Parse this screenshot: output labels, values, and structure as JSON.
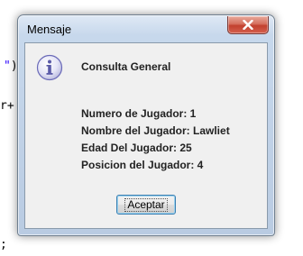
{
  "background": {
    "fragment1_str": "\"",
    "fragment1_rest": ").",
    "fragment2_text": "r+ ",
    "fragment2_str": "\"",
    "fragment3_text": ";"
  },
  "dialog": {
    "title": "Mensaje",
    "icon": "info-icon",
    "heading": "Consulta General",
    "lines": [
      "Numero de Jugador: 1",
      "Nombre del Jugador: Lawliet",
      "Edad Del Jugador: 25",
      "Posicion del Jugador: 4"
    ],
    "ok_label": "Aceptar",
    "close_icon": "close-icon"
  },
  "colors": {
    "code_string": "#2a00ff",
    "close_button": "#c2412f",
    "info_icon": "#6a6ab8"
  }
}
